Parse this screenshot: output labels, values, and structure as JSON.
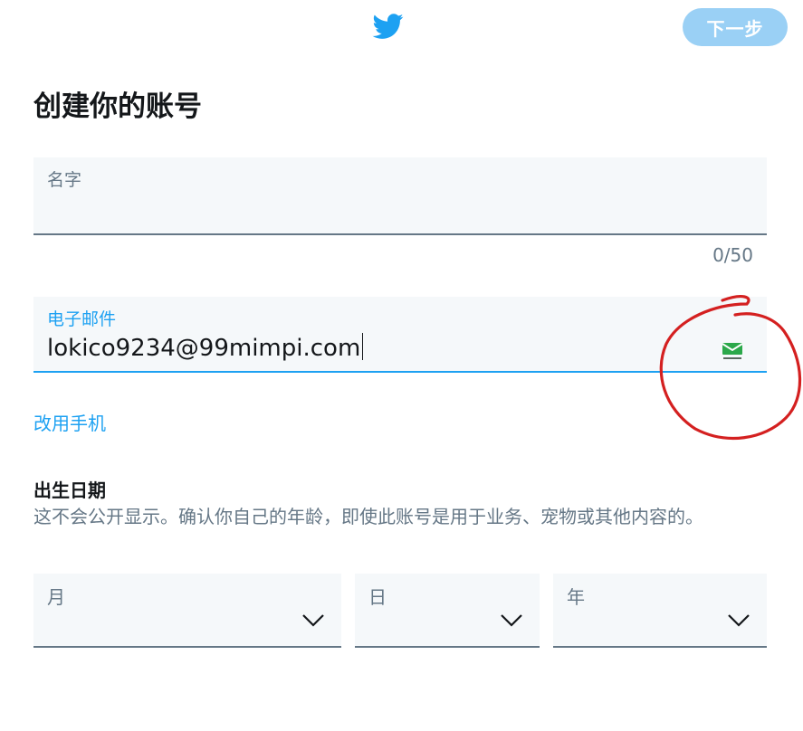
{
  "header": {
    "logo_icon": "twitter-bird-icon",
    "next_label": "下一步",
    "accent_color": "#1da1f2",
    "next_button_color": "#9ad0f5"
  },
  "page": {
    "title": "创建你的账号"
  },
  "name_field": {
    "label": "名字",
    "value": "",
    "counter": "0/50"
  },
  "email_field": {
    "label": "电子邮件",
    "value": "lokico9234@99mimpi.com",
    "extension_icon": "temp-mail-icon",
    "annotation": "red-hand-drawn-circle"
  },
  "use_phone_link": "改用手机",
  "dob": {
    "title": "出生日期",
    "description": "这不会公开显示。确认你自己的年龄，即使此账号是用于业务、宠物或其他内容的。",
    "month_label": "月",
    "day_label": "日",
    "year_label": "年"
  }
}
